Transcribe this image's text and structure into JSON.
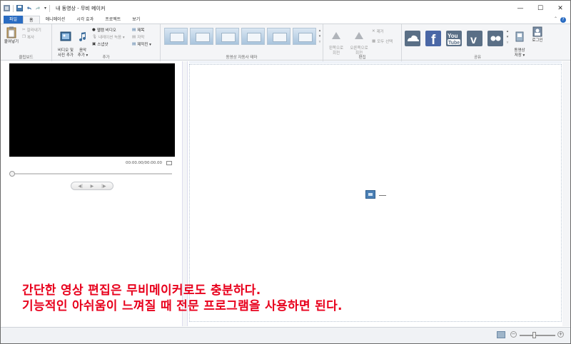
{
  "window": {
    "title": "내 동영상 - 무비 메이커",
    "controls": {
      "minimize": "—",
      "maximize": "☐",
      "close": "✕"
    }
  },
  "tabs": [
    {
      "label": "파일"
    },
    {
      "label": "홈"
    },
    {
      "label": "애니메이션"
    },
    {
      "label": "시각 효과"
    },
    {
      "label": "프로젝트"
    },
    {
      "label": "보기"
    }
  ],
  "ribbon": {
    "clipboard": {
      "label": "클립보드",
      "paste": "붙여넣기",
      "cut": "잘라내기",
      "copy": "복사"
    },
    "add": {
      "label": "추가",
      "add_videos": "비디오 및\n사진 추가",
      "add_music": "음악\n추가 ▾",
      "webcam": "웹캠 비디오",
      "narration": "내레이션 녹음 ▾",
      "snapshot": "스냅샷",
      "title": "제목",
      "caption": "자막",
      "credits": "제작진 ▾"
    },
    "themes": {
      "label": "동영상 자동사 테마"
    },
    "edit": {
      "label": "편집",
      "rotate_left": "왼쪽으로\n회전",
      "rotate_right": "오른쪽으로\n회전",
      "remove": "제거",
      "select_all": "모두 선택"
    },
    "share": {
      "label": "공유",
      "save_movie": "동영상\n저장 ▾",
      "sign_in": "로그인"
    }
  },
  "player": {
    "timecode": "00:00.00/00:00.00",
    "prev": "◀|",
    "play": "▶",
    "next": "|▶"
  },
  "caption": {
    "line1": "간단한 영상 편집은 무비메이커로도 충분하다.",
    "line2": "기능적인 아쉬움이 느껴질 때 전문 프로그램을 사용하면 된다."
  },
  "colors": {
    "file_tab": "#2a6cc2",
    "caption": "#e8001c",
    "onedrive": "#5a6f86",
    "facebook": "#4a67a6",
    "youtube": "#5a6f86",
    "vimeo": "#5a6f86",
    "flickr": "#5a6f86"
  },
  "share_services": [
    "onedrive-icon",
    "facebook-icon",
    "youtube-icon",
    "vimeo-icon",
    "flickr-icon"
  ]
}
